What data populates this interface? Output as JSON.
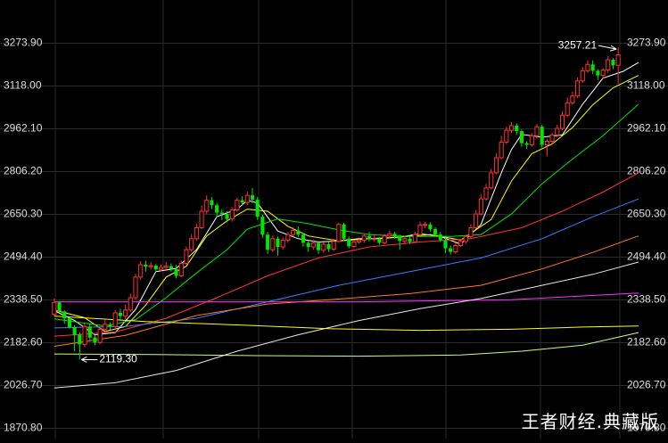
{
  "chart_data": {
    "type": "candlestick",
    "ylim": [
      1870.8,
      3273.9
    ],
    "y_ticks": [
      "3273.90",
      "3118.00",
      "2962.10",
      "2806.20",
      "2650.30",
      "2494.40",
      "2338.50",
      "2182.60",
      "2026.70",
      "1870.80"
    ],
    "grid": true,
    "annotations": {
      "high_label": "3257.21",
      "high_value": 3257.21,
      "low_label": "2119.30",
      "low_value": 2119.3
    },
    "colors": {
      "up": "#ff3232",
      "down": "#00e600",
      "grid": "#2a2a2a",
      "label": "#dcdcdc"
    },
    "candles": [
      [
        2285,
        2328,
        2342,
        2278
      ],
      [
        2328,
        2295,
        2332,
        2290
      ],
      [
        2295,
        2270,
        2300,
        2250
      ],
      [
        2270,
        2238,
        2275,
        2232
      ],
      [
        2238,
        2210,
        2245,
        2150
      ],
      [
        2210,
        2175,
        2218,
        2119.3
      ],
      [
        2175,
        2240,
        2250,
        2165
      ],
      [
        2240,
        2200,
        2248,
        2190
      ],
      [
        2200,
        2182,
        2210,
        2172
      ],
      [
        2182,
        2230,
        2240,
        2176
      ],
      [
        2230,
        2248,
        2265,
        2222
      ],
      [
        2248,
        2240,
        2255,
        2228
      ],
      [
        2240,
        2290,
        2300,
        2235
      ],
      [
        2290,
        2278,
        2305,
        2265
      ],
      [
        2278,
        2300,
        2320,
        2268
      ],
      [
        2300,
        2345,
        2360,
        2292
      ],
      [
        2345,
        2420,
        2432,
        2338
      ],
      [
        2420,
        2465,
        2478,
        2410
      ],
      [
        2465,
        2458,
        2480,
        2440
      ],
      [
        2458,
        2462,
        2475,
        2448
      ],
      [
        2462,
        2448,
        2468,
        2438
      ],
      [
        2448,
        2455,
        2465,
        2440
      ],
      [
        2455,
        2460,
        2475,
        2450
      ],
      [
        2460,
        2450,
        2470,
        2440
      ],
      [
        2450,
        2425,
        2465,
        2415
      ],
      [
        2425,
        2470,
        2480,
        2420
      ],
      [
        2470,
        2520,
        2532,
        2465
      ],
      [
        2520,
        2560,
        2575,
        2512
      ],
      [
        2560,
        2600,
        2615,
        2552
      ],
      [
        2600,
        2660,
        2680,
        2595
      ],
      [
        2660,
        2700,
        2718,
        2650
      ],
      [
        2700,
        2682,
        2712,
        2668
      ],
      [
        2682,
        2655,
        2690,
        2638
      ],
      [
        2655,
        2650,
        2668,
        2628
      ],
      [
        2650,
        2632,
        2660,
        2620
      ],
      [
        2632,
        2665,
        2675,
        2622
      ],
      [
        2665,
        2700,
        2710,
        2658
      ],
      [
        2700,
        2692,
        2715,
        2680
      ],
      [
        2692,
        2718,
        2732,
        2682
      ],
      [
        2718,
        2702,
        2745,
        2690
      ],
      [
        2702,
        2640,
        2712,
        2628
      ],
      [
        2640,
        2575,
        2648,
        2562
      ],
      [
        2575,
        2520,
        2585,
        2505
      ],
      [
        2520,
        2560,
        2572,
        2512
      ],
      [
        2560,
        2530,
        2568,
        2498
      ],
      [
        2530,
        2555,
        2565,
        2520
      ],
      [
        2555,
        2575,
        2585,
        2545
      ],
      [
        2575,
        2590,
        2602,
        2568
      ],
      [
        2590,
        2575,
        2605,
        2565
      ],
      [
        2575,
        2545,
        2582,
        2530
      ],
      [
        2545,
        2530,
        2552,
        2512
      ],
      [
        2530,
        2545,
        2555,
        2520
      ],
      [
        2545,
        2518,
        2552,
        2505
      ],
      [
        2518,
        2540,
        2548,
        2510
      ],
      [
        2540,
        2522,
        2548,
        2512
      ],
      [
        2522,
        2550,
        2560,
        2515
      ],
      [
        2550,
        2612,
        2618,
        2545
      ],
      [
        2612,
        2560,
        2618,
        2552
      ],
      [
        2560,
        2532,
        2568,
        2525
      ],
      [
        2532,
        2548,
        2556,
        2526
      ],
      [
        2548,
        2555,
        2565,
        2542
      ],
      [
        2555,
        2570,
        2580,
        2545
      ],
      [
        2570,
        2558,
        2585,
        2550
      ],
      [
        2558,
        2560,
        2572,
        2550
      ],
      [
        2560,
        2545,
        2566,
        2538
      ],
      [
        2545,
        2570,
        2578,
        2540
      ],
      [
        2570,
        2578,
        2590,
        2562
      ],
      [
        2578,
        2568,
        2585,
        2560
      ],
      [
        2568,
        2552,
        2575,
        2520
      ],
      [
        2552,
        2560,
        2570,
        2540
      ],
      [
        2560,
        2548,
        2568,
        2540
      ],
      [
        2548,
        2575,
        2585,
        2545
      ],
      [
        2575,
        2610,
        2622,
        2570
      ],
      [
        2610,
        2612,
        2622,
        2598
      ],
      [
        2612,
        2595,
        2620,
        2585
      ],
      [
        2595,
        2575,
        2602,
        2568
      ],
      [
        2575,
        2555,
        2585,
        2548
      ],
      [
        2555,
        2525,
        2565,
        2508
      ],
      [
        2525,
        2512,
        2535,
        2502
      ],
      [
        2512,
        2535,
        2545,
        2505
      ],
      [
        2535,
        2550,
        2558,
        2530
      ],
      [
        2550,
        2568,
        2575,
        2542
      ],
      [
        2568,
        2600,
        2612,
        2562
      ],
      [
        2600,
        2650,
        2665,
        2595
      ],
      [
        2650,
        2705,
        2722,
        2645
      ],
      [
        2705,
        2745,
        2760,
        2698
      ],
      [
        2745,
        2800,
        2815,
        2740
      ],
      [
        2800,
        2855,
        2872,
        2795
      ],
      [
        2855,
        2912,
        2935,
        2850
      ],
      [
        2912,
        2955,
        2968,
        2905
      ],
      [
        2955,
        2972,
        2985,
        2945
      ],
      [
        2972,
        2952,
        2980,
        2938
      ],
      [
        2952,
        2908,
        2958,
        2895
      ],
      [
        2908,
        2902,
        2915,
        2888
      ],
      [
        2902,
        2935,
        2945,
        2895
      ],
      [
        2935,
        2968,
        2978,
        2925
      ],
      [
        2968,
        2902,
        2975,
        2892
      ],
      [
        2902,
        2915,
        2925,
        2860
      ],
      [
        2915,
        2938,
        2945,
        2905
      ],
      [
        2938,
        2962,
        2975,
        2930
      ],
      [
        2962,
        3010,
        3025,
        2955
      ],
      [
        3010,
        3055,
        3075,
        3002
      ],
      [
        3055,
        3080,
        3095,
        3048
      ],
      [
        3080,
        3135,
        3148,
        3072
      ],
      [
        3135,
        3172,
        3185,
        3128
      ],
      [
        3172,
        3195,
        3210,
        3165
      ],
      [
        3195,
        3172,
        3210,
        3160
      ],
      [
        3172,
        3155,
        3178,
        3138
      ],
      [
        3155,
        3175,
        3182,
        3142
      ],
      [
        3175,
        3212,
        3225,
        3165
      ],
      [
        3212,
        3192,
        3218,
        3178
      ],
      [
        3192,
        3230,
        3257.21,
        3125
      ]
    ],
    "moving_averages": [
      {
        "color": "#ffffff",
        "values": [
          [
            0,
            2298
          ],
          [
            4,
            2262
          ],
          [
            8,
            2210
          ],
          [
            12,
            2218
          ],
          [
            16,
            2302
          ],
          [
            20,
            2440
          ],
          [
            24,
            2452
          ],
          [
            28,
            2520
          ],
          [
            32,
            2640
          ],
          [
            36,
            2668
          ],
          [
            38,
            2700
          ],
          [
            40,
            2690
          ],
          [
            44,
            2588
          ],
          [
            48,
            2560
          ],
          [
            52,
            2548
          ],
          [
            56,
            2552
          ],
          [
            60,
            2560
          ],
          [
            64,
            2560
          ],
          [
            68,
            2566
          ],
          [
            72,
            2578
          ],
          [
            76,
            2568
          ],
          [
            80,
            2540
          ],
          [
            84,
            2612
          ],
          [
            88,
            2800
          ],
          [
            90,
            2885
          ],
          [
            92,
            2940
          ],
          [
            96,
            2930
          ],
          [
            100,
            2938
          ],
          [
            104,
            3050
          ],
          [
            108,
            3145
          ],
          [
            112,
            3170
          ],
          [
            115,
            3202
          ]
        ]
      },
      {
        "color": "#ffff00",
        "values": [
          [
            0,
            2300
          ],
          [
            6,
            2272
          ],
          [
            10,
            2222
          ],
          [
            14,
            2240
          ],
          [
            18,
            2318
          ],
          [
            22,
            2420
          ],
          [
            26,
            2460
          ],
          [
            30,
            2570
          ],
          [
            34,
            2625
          ],
          [
            38,
            2668
          ],
          [
            42,
            2660
          ],
          [
            46,
            2605
          ],
          [
            50,
            2570
          ],
          [
            56,
            2552
          ],
          [
            62,
            2560
          ],
          [
            68,
            2566
          ],
          [
            74,
            2575
          ],
          [
            80,
            2555
          ],
          [
            86,
            2630
          ],
          [
            90,
            2770
          ],
          [
            94,
            2870
          ],
          [
            98,
            2905
          ],
          [
            102,
            2965
          ],
          [
            106,
            3048
          ],
          [
            110,
            3110
          ],
          [
            115,
            3155
          ]
        ]
      },
      {
        "color": "#00e600",
        "values": [
          [
            0,
            2268
          ],
          [
            10,
            2242
          ],
          [
            16,
            2265
          ],
          [
            22,
            2345
          ],
          [
            28,
            2435
          ],
          [
            34,
            2520
          ],
          [
            38,
            2595
          ],
          [
            44,
            2632
          ],
          [
            50,
            2615
          ],
          [
            56,
            2592
          ],
          [
            62,
            2575
          ],
          [
            70,
            2568
          ],
          [
            78,
            2568
          ],
          [
            84,
            2575
          ],
          [
            90,
            2650
          ],
          [
            96,
            2760
          ],
          [
            102,
            2850
          ],
          [
            108,
            2935
          ],
          [
            115,
            3050
          ]
        ]
      },
      {
        "color": "#ff3232",
        "values": [
          [
            0,
            2205
          ],
          [
            12,
            2220
          ],
          [
            22,
            2270
          ],
          [
            32,
            2345
          ],
          [
            42,
            2425
          ],
          [
            52,
            2490
          ],
          [
            62,
            2530
          ],
          [
            72,
            2548
          ],
          [
            82,
            2560
          ],
          [
            92,
            2600
          ],
          [
            100,
            2660
          ],
          [
            108,
            2730
          ],
          [
            115,
            2800
          ]
        ]
      },
      {
        "color": "#3a7cff",
        "values": [
          [
            0,
            2235
          ],
          [
            14,
            2240
          ],
          [
            28,
            2270
          ],
          [
            42,
            2330
          ],
          [
            56,
            2390
          ],
          [
            70,
            2440
          ],
          [
            84,
            2490
          ],
          [
            96,
            2560
          ],
          [
            106,
            2640
          ],
          [
            115,
            2705
          ]
        ]
      },
      {
        "color": "#ff7a1e",
        "values": [
          [
            0,
            2168
          ],
          [
            14,
            2208
          ],
          [
            28,
            2280
          ],
          [
            42,
            2322
          ],
          [
            56,
            2340
          ],
          [
            70,
            2360
          ],
          [
            84,
            2390
          ],
          [
            96,
            2450
          ],
          [
            106,
            2510
          ],
          [
            115,
            2570
          ]
        ]
      },
      {
        "color": "#ff32ff",
        "values": [
          [
            0,
            2330
          ],
          [
            30,
            2330
          ],
          [
            60,
            2330
          ],
          [
            90,
            2338
          ],
          [
            115,
            2362
          ]
        ]
      },
      {
        "color": "#ffff00",
        "values": [
          [
            0,
            2278
          ],
          [
            18,
            2258
          ],
          [
            36,
            2246
          ],
          [
            54,
            2232
          ],
          [
            72,
            2226
          ],
          [
            90,
            2230
          ],
          [
            104,
            2238
          ],
          [
            115,
            2242
          ]
        ]
      },
      {
        "color": "#c8ff80",
        "values": [
          [
            0,
            2140
          ],
          [
            20,
            2138
          ],
          [
            40,
            2134
          ],
          [
            60,
            2132
          ],
          [
            80,
            2136
          ],
          [
            92,
            2150
          ],
          [
            104,
            2172
          ],
          [
            115,
            2218
          ]
        ]
      },
      {
        "color": "#e6e6e6",
        "values": [
          [
            0,
            2016
          ],
          [
            12,
            2035
          ],
          [
            24,
            2080
          ],
          [
            36,
            2150
          ],
          [
            48,
            2210
          ],
          [
            60,
            2262
          ],
          [
            72,
            2305
          ],
          [
            84,
            2342
          ],
          [
            96,
            2390
          ],
          [
            106,
            2430
          ],
          [
            115,
            2475
          ]
        ]
      }
    ]
  },
  "watermark": "王者财经.典藏版"
}
